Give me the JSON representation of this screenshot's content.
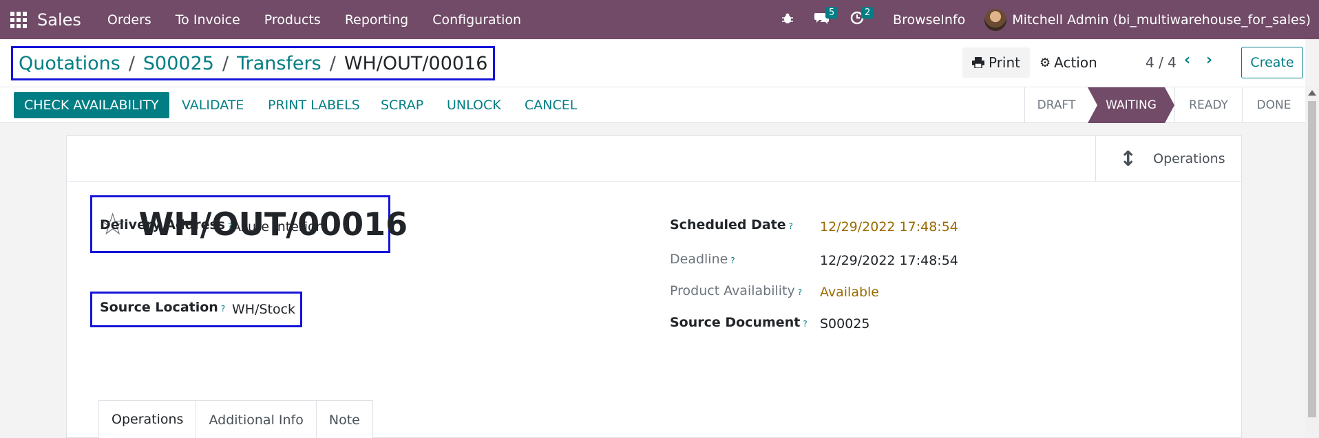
{
  "navbar": {
    "app_name": "Sales",
    "menu": [
      "Orders",
      "To Invoice",
      "Products",
      "Reporting",
      "Configuration"
    ],
    "messages_count": "5",
    "activities_count": "2",
    "company": "BrowseInfo",
    "user": "Mitchell Admin (bi_multiwarehouse_for_sales)"
  },
  "breadcrumb": {
    "items": [
      "Quotations",
      "S00025",
      "Transfers"
    ],
    "current": "WH/OUT/00016"
  },
  "control": {
    "print_label": "Print",
    "action_label": "Action",
    "pager": "4 / 4",
    "create_label": "Create"
  },
  "statusbar": {
    "buttons": [
      "CHECK AVAILABILITY",
      "VALIDATE",
      "PRINT LABELS",
      "SCRAP",
      "UNLOCK",
      "CANCEL"
    ],
    "stages": [
      "DRAFT",
      "WAITING",
      "READY",
      "DONE"
    ],
    "active_stage": "WAITING"
  },
  "sheet": {
    "operations_button": "Operations",
    "title": "WH/OUT/00016",
    "fields": {
      "delivery_address": {
        "label": "Delivery Address",
        "value": "Azure Interior"
      },
      "source_location": {
        "label": "Source Location",
        "value": "WH/Stock"
      },
      "scheduled_date": {
        "label": "Scheduled Date",
        "value": "12/29/2022 17:48:54"
      },
      "deadline": {
        "label": "Deadline",
        "value": "12/29/2022 17:48:54"
      },
      "product_availability": {
        "label": "Product Availability",
        "value": "Available"
      },
      "source_document": {
        "label": "Source Document",
        "value": "S00025"
      }
    },
    "help_mark": "?",
    "tabs": [
      "Operations",
      "Additional Info",
      "Note"
    ]
  },
  "colors": {
    "navbar": "#714b67",
    "primary": "#017e84",
    "highlight_box": "#1414d8",
    "warning_text": "#9a6b00"
  }
}
